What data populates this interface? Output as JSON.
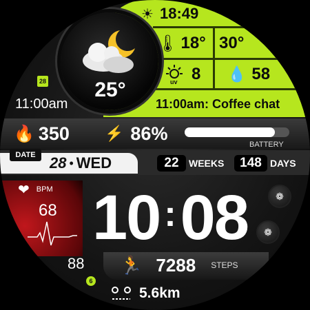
{
  "weather": {
    "sunset_time": "18:49",
    "temp_now": "25°",
    "temp_low": "18°",
    "temp_high": "30°",
    "uv": "8",
    "humidity": "58",
    "icon": "night-cloud-moon-icon"
  },
  "calendar": {
    "day_badge": "28",
    "event_time": "11:00am",
    "event_line": "11:00am: Coffee chat"
  },
  "activity": {
    "calories": "350",
    "heart_bpm": "68",
    "heart_label": "BPM",
    "steps": "7288",
    "steps_label": "STEPS",
    "distance": "5.6km",
    "floors": "88",
    "floors_badge": "6"
  },
  "battery": {
    "percent_text": "86%",
    "label": "BATTERY",
    "level": 0.86
  },
  "date": {
    "label": "DATE",
    "day_num": "28",
    "separator": "•",
    "weekday": "WED",
    "weeks_value": "22",
    "weeks_label": "WEEKS",
    "days_value": "148",
    "days_label": "DAYS"
  },
  "time": {
    "hours": "10",
    "separator": ":",
    "minutes": "08"
  },
  "colors": {
    "accent": "#b6e61e",
    "heart_red": "#c0171c",
    "distance_dot": "#b6e61e"
  }
}
